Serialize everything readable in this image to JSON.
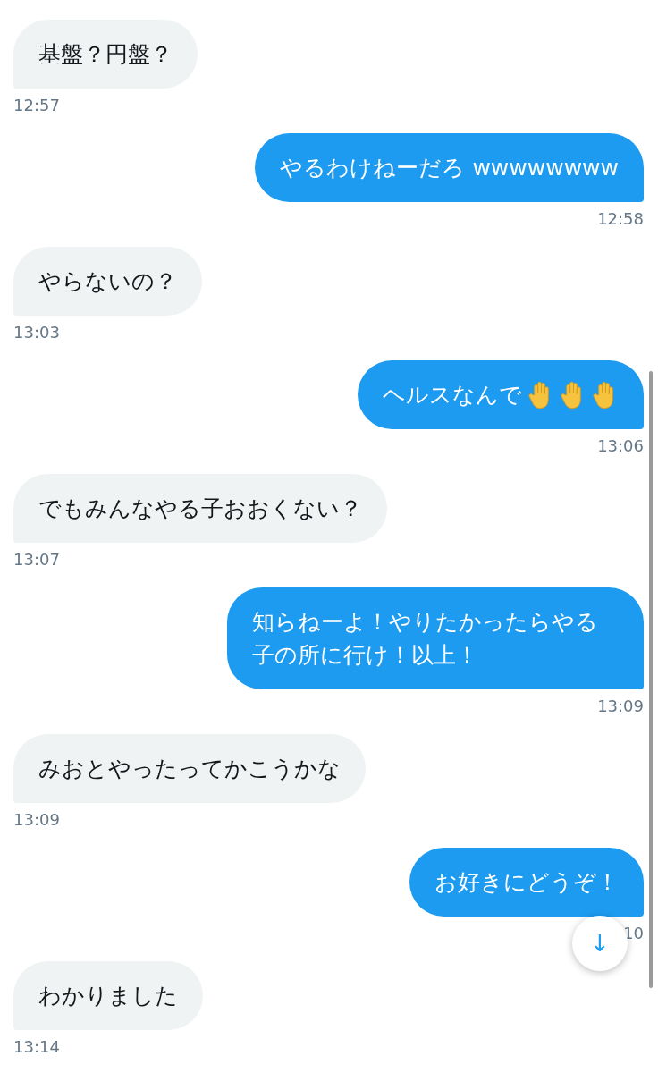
{
  "messages": [
    {
      "kind": "received",
      "text": "基盤？円盤？",
      "time": "12:57"
    },
    {
      "kind": "sent",
      "text": "やるわけねーだろ wwwwwwww",
      "time": "12:58"
    },
    {
      "kind": "received",
      "text": "やらないの？",
      "time": "13:03"
    },
    {
      "kind": "sent",
      "text": "ヘルスなんで",
      "icons": [
        {
          "kind": "hand"
        },
        {
          "kind": "hand"
        },
        {
          "kind": "hand"
        }
      ],
      "time": "13:06"
    },
    {
      "kind": "received",
      "text": "でもみんなやる子おおくない？",
      "time": "13:07"
    },
    {
      "kind": "sent",
      "text": "知らねーよ！やりたかったらやる子の所に行け！以上！",
      "time": "13:09"
    },
    {
      "kind": "received",
      "text": "みおとやったってかこうかな",
      "time": "13:09"
    },
    {
      "kind": "sent",
      "text": "お好きにどうぞ！",
      "time": "10"
    },
    {
      "kind": "received",
      "text": "わかりました",
      "time": "13:14"
    }
  ],
  "scroll_down_button": {
    "icon": "↓"
  }
}
